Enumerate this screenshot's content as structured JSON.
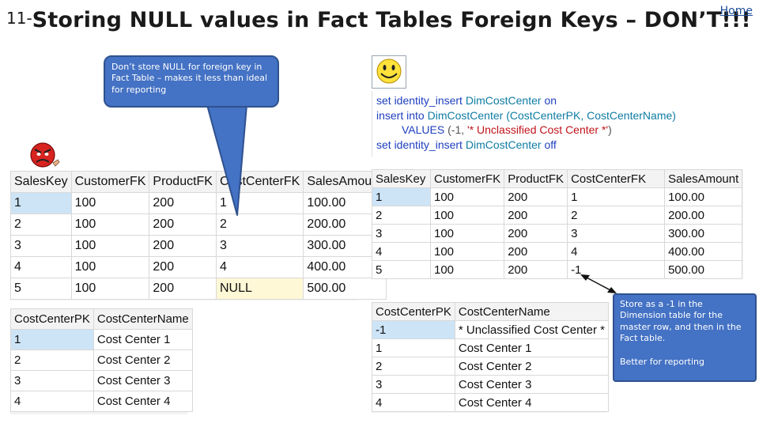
{
  "slide": {
    "number": "11-",
    "title": "Storing NULL values in Fact Tables Foreign Keys – DON’T!!!",
    "home_link": "Home"
  },
  "callouts": {
    "bad_text": "Don’t store NULL for foreign key in Fact Table – makes it less than ideal for reporting",
    "good_line1": "Store as a -1 in the Dimension table for the master row, and then in the Fact table.",
    "good_line2": "Better for reporting"
  },
  "icons": {
    "good": "smiley-face-icon",
    "bad": "angry-face-icon"
  },
  "sql": {
    "line1": {
      "kw": "set identity_insert",
      "obj": "DimCostCenter",
      "kw2": "on"
    },
    "line2": {
      "kw": "insert into",
      "obj": "DimCostCenter",
      "cols": "(CostCenterPK, CostCenterName)"
    },
    "line3": {
      "kw": "VALUES",
      "open": "(",
      "num": "-1",
      "sep": ",",
      "str": "'* Unclassified Cost Center *'",
      "close": ")"
    },
    "line4": {
      "kw": "set identity_insert",
      "obj": "DimCostCenter",
      "kw2": "off"
    }
  },
  "fact_bad": {
    "headers": [
      "SalesKey",
      "CustomerFK",
      "ProductFK",
      "CostCenterFK",
      "SalesAmount"
    ],
    "rows": [
      [
        "1",
        "100",
        "200",
        "1",
        "100.00"
      ],
      [
        "2",
        "100",
        "200",
        "2",
        "200.00"
      ],
      [
        "3",
        "100",
        "200",
        "3",
        "300.00"
      ],
      [
        "4",
        "100",
        "200",
        "4",
        "400.00"
      ],
      [
        "5",
        "100",
        "200",
        "NULL",
        "500.00"
      ]
    ]
  },
  "dim_bad": {
    "headers": [
      "CostCenterPK",
      "CostCenterName"
    ],
    "rows": [
      [
        "1",
        "Cost Center 1"
      ],
      [
        "2",
        "Cost Center 2"
      ],
      [
        "3",
        "Cost Center 3"
      ],
      [
        "4",
        "Cost Center 4"
      ]
    ]
  },
  "fact_good": {
    "headers": [
      "SalesKey",
      "CustomerFK",
      "ProductFK",
      "CostCenterFK",
      "SalesAmount"
    ],
    "rows": [
      [
        "1",
        "100",
        "200",
        "1",
        "100.00"
      ],
      [
        "2",
        "100",
        "200",
        "2",
        "200.00"
      ],
      [
        "3",
        "100",
        "200",
        "3",
        "300.00"
      ],
      [
        "4",
        "100",
        "200",
        "4",
        "400.00"
      ],
      [
        "5",
        "100",
        "200",
        "-1",
        "500.00"
      ]
    ]
  },
  "dim_good": {
    "headers": [
      "CostCenterPK",
      "CostCenterName"
    ],
    "rows": [
      [
        "-1",
        "* Unclassified Cost Center *"
      ],
      [
        "1",
        "Cost Center 1"
      ],
      [
        "2",
        "Cost Center 2"
      ],
      [
        "3",
        "Cost Center 3"
      ],
      [
        "4",
        "Cost Center 4"
      ]
    ]
  },
  "colors": {
    "callout": "#4472c4",
    "home_link": "#1f4e9b",
    "selection": "#cde4f7"
  }
}
